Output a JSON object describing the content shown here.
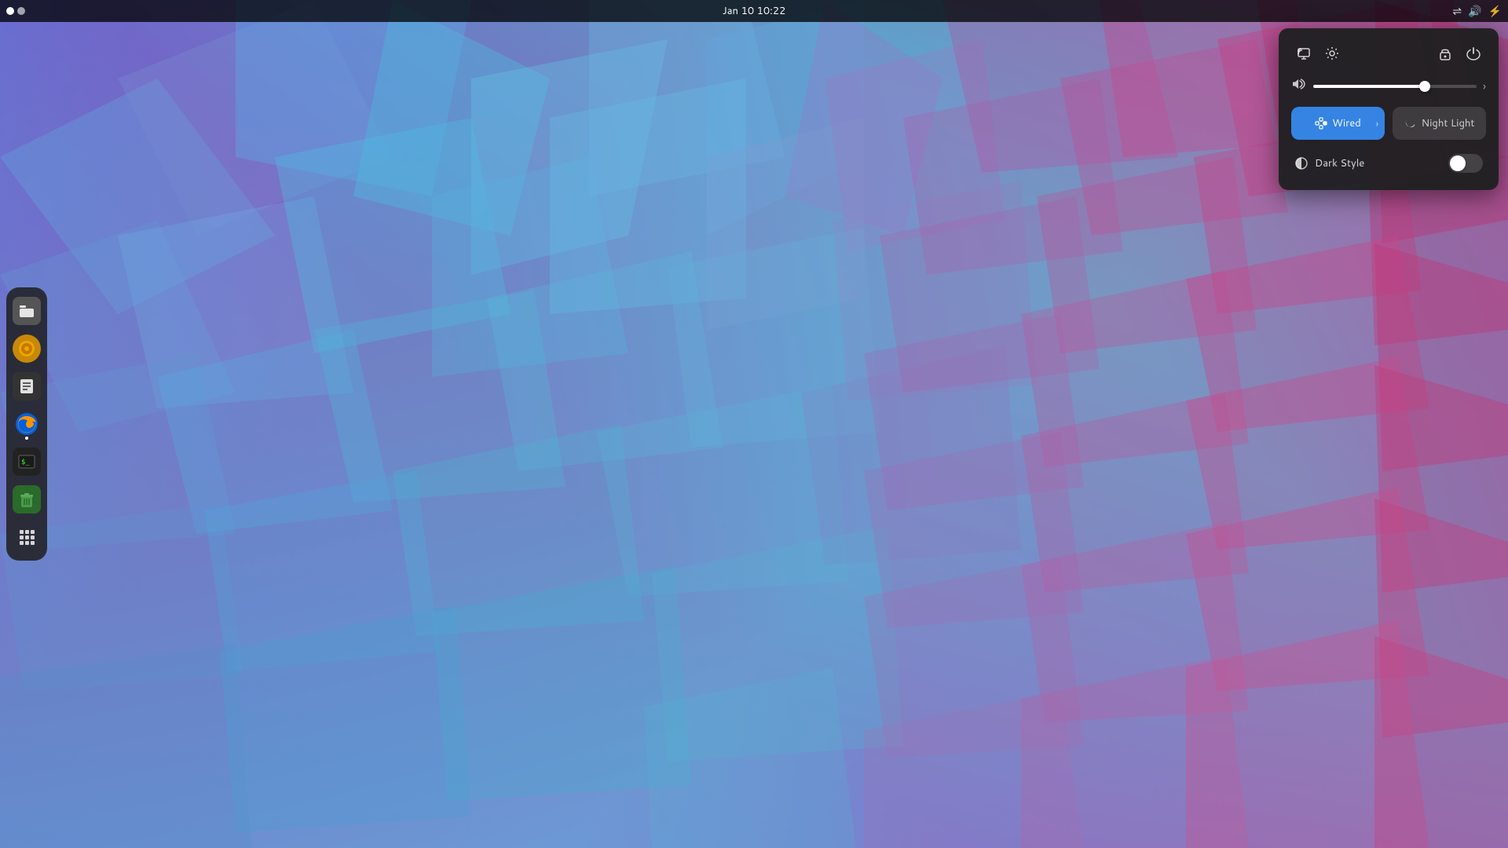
{
  "topbar": {
    "datetime": "Jan 10  10:22",
    "left_dot_active": true
  },
  "sidebar": {
    "items": [
      {
        "id": "app1",
        "label": "Files",
        "icon": "file-manager-icon",
        "color": "#555"
      },
      {
        "id": "app2",
        "label": "PiP",
        "icon": "media-icon",
        "color": "#e8a800"
      },
      {
        "id": "app3",
        "label": "Calendar",
        "icon": "calendar-icon",
        "color": "#444"
      },
      {
        "id": "app4",
        "label": "Firefox",
        "icon": "firefox-icon",
        "color": "#e55b00"
      },
      {
        "id": "app5",
        "label": "Terminal",
        "icon": "terminal-icon",
        "color": "#333"
      },
      {
        "id": "app6",
        "label": "Trash",
        "icon": "trash-icon",
        "color": "#3a7a3a"
      },
      {
        "id": "apps-grid",
        "label": "All Apps",
        "icon": "apps-grid-icon",
        "color": "transparent"
      }
    ]
  },
  "quick_settings": {
    "icons": {
      "screen_icon": "🖥",
      "settings_icon": "⚙",
      "lock_icon": "🔒",
      "power_icon": "⏻"
    },
    "volume": {
      "icon": "🔊",
      "value": 68,
      "percent": 68
    },
    "wired_button": {
      "label": "Wired",
      "active": true,
      "has_arrow": true
    },
    "night_light_button": {
      "label": "Night Light",
      "active": false,
      "has_arrow": false
    },
    "dark_style": {
      "label": "Dark Style",
      "enabled": false
    }
  }
}
